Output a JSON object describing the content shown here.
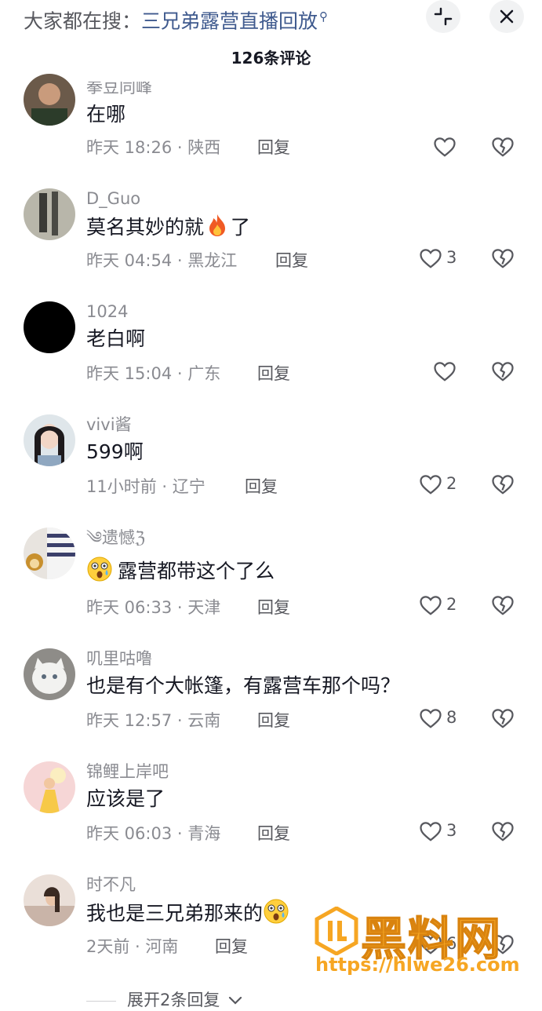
{
  "header": {
    "search_prefix": "大家都在搜：",
    "search_link": "三兄弟露营直播回放",
    "comment_count": "126条评论"
  },
  "comments": [
    {
      "username": "拳豆同峰",
      "text": "在哪",
      "time": "昨天 18:26",
      "location": "陕西",
      "reply": "回复",
      "likes": ""
    },
    {
      "username": "D_Guo",
      "text": "莫名其妙的就",
      "text_after": "了",
      "time": "昨天 04:54",
      "location": "黑龙江",
      "reply": "回复",
      "likes": "3"
    },
    {
      "username": "1024",
      "text": "老白啊",
      "time": "昨天 15:04",
      "location": "广东",
      "reply": "回复",
      "likes": ""
    },
    {
      "username": "vivi酱",
      "text": "599啊",
      "time": "11小时前",
      "location": "辽宁",
      "reply": "回复",
      "likes": "2"
    },
    {
      "username": "༄遗憾ℨ",
      "text": "露营都带这个了么",
      "time": "昨天 06:33",
      "location": "天津",
      "reply": "回复",
      "likes": "2"
    },
    {
      "username": "叽里咕噜",
      "text": "也是有个大帐篷，有露营车那个吗？",
      "time": "昨天 12:57",
      "location": "云南",
      "reply": "回复",
      "likes": "8"
    },
    {
      "username": "锦鲤上岸吧",
      "text": "应该是了",
      "time": "昨天 06:03",
      "location": "青海",
      "reply": "回复",
      "likes": "3"
    },
    {
      "username": "时不凡",
      "text": "我也是三兄弟那来的",
      "time": "2天前",
      "location": "河南",
      "reply": "回复",
      "likes": "61"
    }
  ],
  "expand_replies": "展开2条回复",
  "watermark": {
    "title": "黑料网",
    "url": "https://hlwe26.com"
  },
  "icons": {
    "search": "search-icon",
    "collapse": "collapse-icon",
    "close": "close-icon",
    "like": "heart-icon",
    "dislike": "broken-heart-icon",
    "fire": "fire-emoji",
    "shocked": "shocked-face-emoji"
  },
  "colors": {
    "link": "#3f5a8e",
    "secondary_text": "#8a8b91",
    "primary_text": "#161823",
    "watermark": "#f6a623"
  }
}
